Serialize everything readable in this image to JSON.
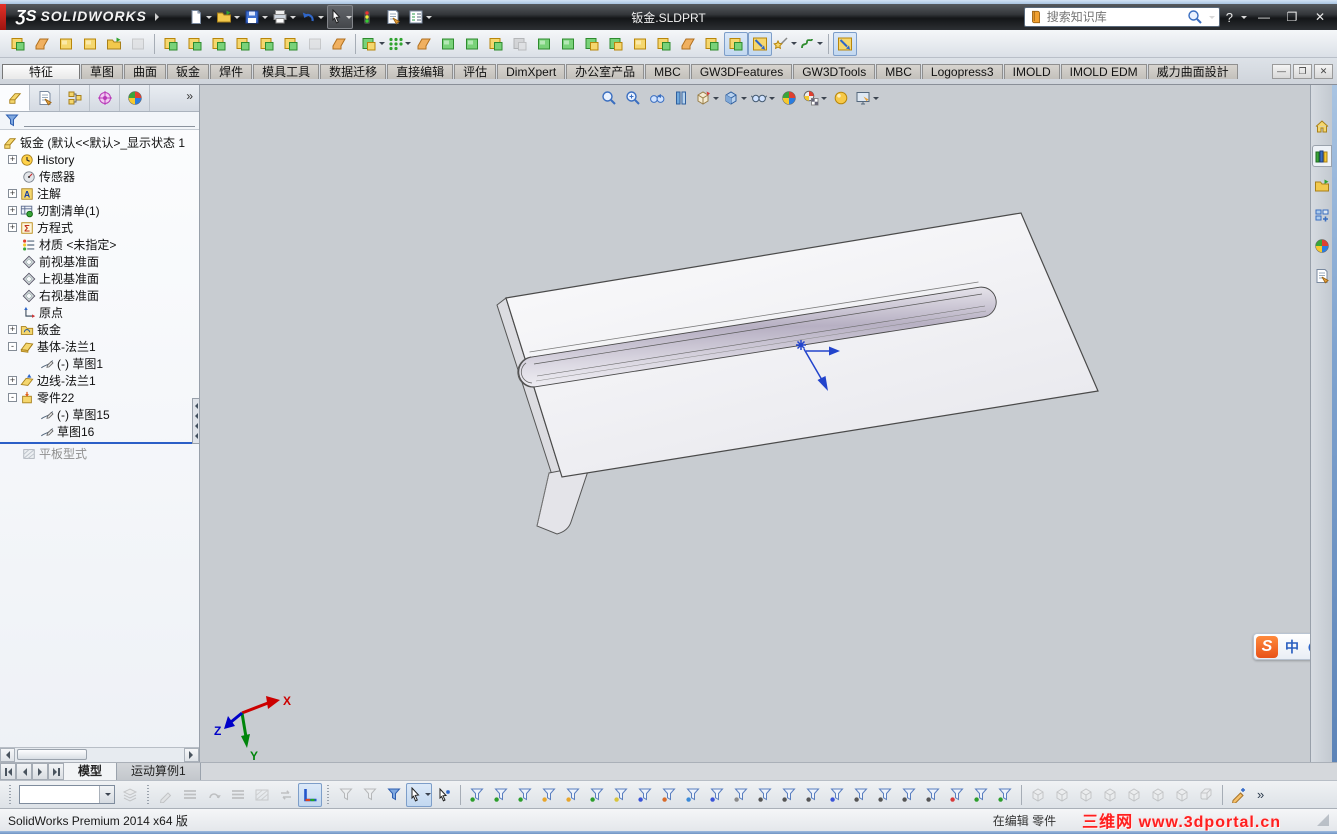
{
  "titlebar": {
    "ds_mark": "ƷS",
    "brand": "SOLIDWORKS",
    "title": "钣金.SLDPRT",
    "search_placeholder": "搜索知识库",
    "help": "?",
    "win_min": "—",
    "win_max": "❐",
    "win_close": "✕"
  },
  "quick_access": [
    {
      "n": "new-document",
      "k": "doc",
      "caret": true
    },
    {
      "n": "open-document",
      "k": "folder",
      "caret": true
    },
    {
      "n": "save",
      "k": "disk",
      "caret": true
    },
    {
      "n": "print",
      "k": "printer",
      "caret": true
    },
    {
      "n": "undo",
      "k": "undo",
      "caret": true
    },
    {
      "n": "select",
      "k": "cursor",
      "caret": true,
      "boxed": true
    },
    {
      "n": "rebuild-stoplight",
      "k": "stoplight"
    },
    {
      "n": "file-properties",
      "k": "sheet"
    },
    {
      "n": "options-list",
      "k": "list",
      "caret": true
    }
  ],
  "sheetmetal_toolbar": [
    {
      "n": "base-flange",
      "k": "yg"
    },
    {
      "n": "sketched-bend",
      "k": "orange"
    },
    {
      "n": "lofted-bend",
      "k": "y"
    },
    {
      "n": "swept-flange",
      "k": "y"
    },
    {
      "n": "open-part",
      "k": "folder"
    },
    {
      "n": "fold-gray",
      "k": "gray",
      "dis": true
    },
    {
      "t": "sep"
    },
    {
      "n": "extruded-cut",
      "k": "yg"
    },
    {
      "n": "simple-hole",
      "k": "yg"
    },
    {
      "n": "vent",
      "k": "yg"
    },
    {
      "n": "forming-tool",
      "k": "yg"
    },
    {
      "n": "sketch-driven",
      "k": "yg"
    },
    {
      "n": "tab-feature",
      "k": "yg"
    },
    {
      "n": "swap-gray",
      "k": "gray",
      "dis": true
    },
    {
      "n": "stacked-sheet",
      "k": "orange"
    },
    {
      "t": "sep"
    },
    {
      "n": "corner-relief",
      "k": "gy",
      "caret": true
    },
    {
      "n": "pattern-grid",
      "k": "grid",
      "caret": true
    },
    {
      "n": "miter-flange",
      "k": "orange"
    },
    {
      "n": "edge-flange",
      "k": "g"
    },
    {
      "n": "hem",
      "k": "g"
    },
    {
      "n": "jog",
      "k": "yg"
    },
    {
      "n": "closed-corner",
      "k": "gy",
      "dis": true
    },
    {
      "n": "round-boss",
      "k": "g"
    },
    {
      "n": "curl",
      "k": "g"
    },
    {
      "n": "gusset",
      "k": "gy"
    },
    {
      "n": "cross-break",
      "k": "gy"
    },
    {
      "n": "rip",
      "k": "y"
    },
    {
      "n": "canister",
      "k": "yg"
    },
    {
      "n": "break-corner",
      "k": "orange"
    },
    {
      "n": "weld-corner",
      "k": "yg"
    },
    {
      "n": "flatten",
      "k": "yg",
      "pressed": true
    },
    {
      "n": "insert-bends",
      "k": "bluearrow",
      "pressed": true
    },
    {
      "n": "convert-wand",
      "k": "wand",
      "caret": true
    },
    {
      "n": "spline-tool",
      "k": "squig",
      "caret": true
    },
    {
      "t": "sep"
    },
    {
      "n": "no-bends",
      "k": "bluearrow",
      "pressed": true
    }
  ],
  "commandmanager": {
    "tabs": [
      {
        "label": "特征",
        "active": true
      },
      {
        "label": "草图"
      },
      {
        "label": "曲面"
      },
      {
        "label": "钣金"
      },
      {
        "label": "焊件"
      },
      {
        "label": "模具工具"
      },
      {
        "label": "数据迁移"
      },
      {
        "label": "直接编辑"
      },
      {
        "label": "评估"
      },
      {
        "label": "DimXpert"
      },
      {
        "label": "办公室产品"
      },
      {
        "label": "MBC"
      },
      {
        "label": "GW3DFeatures"
      },
      {
        "label": "GW3DTools"
      },
      {
        "label": "MBC"
      },
      {
        "label": "Logopress3"
      },
      {
        "label": "IMOLD"
      },
      {
        "label": "IMOLD EDM"
      },
      {
        "label": "威力曲面設計"
      }
    ],
    "doc_min": "—",
    "doc_restore": "❐",
    "doc_close": "✕"
  },
  "featuremanager": {
    "tabs": [
      {
        "n": "featuremanager-design-tree",
        "k": "part",
        "active": true
      },
      {
        "n": "propertymanager",
        "k": "sheet"
      },
      {
        "n": "configurationmanager",
        "k": "config"
      },
      {
        "n": "dimxpertmanager",
        "k": "target"
      },
      {
        "n": "displaymanager",
        "k": "rgb"
      }
    ],
    "overflow": "»",
    "plus": "+",
    "minus": "-",
    "root": "钣金 (默认<<默认>_显示状态 1",
    "items": [
      {
        "label": "History",
        "icon": "history",
        "expand": "plus"
      },
      {
        "label": "传感器",
        "icon": "sensors"
      },
      {
        "label": "注解",
        "icon": "annA",
        "expand": "plus"
      },
      {
        "label": "切割清单(1)",
        "icon": "cutlist",
        "expand": "plus"
      },
      {
        "label": "方程式",
        "icon": "sigma",
        "expand": "plus"
      },
      {
        "label": "材质 <未指定>",
        "icon": "material"
      },
      {
        "label": "前视基准面",
        "icon": "plane"
      },
      {
        "label": "上视基准面",
        "icon": "plane"
      },
      {
        "label": "右视基准面",
        "icon": "plane"
      },
      {
        "label": "原点",
        "icon": "origin"
      },
      {
        "label": "钣金",
        "icon": "smfold",
        "expand": "plus"
      },
      {
        "label": "基体-法兰1",
        "icon": "baseflange",
        "expand": "minus"
      },
      {
        "label": "(-) 草图1",
        "icon": "sketch",
        "indent": 1
      },
      {
        "label": "边线-法兰1",
        "icon": "edgeflange",
        "expand": "plus"
      },
      {
        "label": "零件22",
        "icon": "part22",
        "expand": "minus"
      },
      {
        "label": "(-) 草图15",
        "icon": "sketch",
        "indent": 1
      },
      {
        "label": "草图16",
        "icon": "sketch",
        "indent": 1
      },
      {
        "label": "平板型式",
        "icon": "flatpat",
        "dim": true,
        "below_rollback": true
      }
    ]
  },
  "headsup": [
    {
      "n": "zoom-to-fit",
      "k": "mag"
    },
    {
      "n": "zoom-to-area",
      "k": "magp"
    },
    {
      "n": "previous-view",
      "k": "binoc"
    },
    {
      "n": "section-view",
      "k": "section"
    },
    {
      "n": "view-orientation",
      "k": "cubeor",
      "caret": true
    },
    {
      "n": "display-style",
      "k": "cubebl",
      "caret": true
    },
    {
      "n": "hide-show-items",
      "k": "glasses",
      "caret": true
    },
    {
      "n": "edit-appearance",
      "k": "rgb"
    },
    {
      "n": "apply-scene",
      "k": "checker",
      "caret": true
    },
    {
      "n": "view-settings-light",
      "k": "bally"
    },
    {
      "n": "camera-settings",
      "k": "monitor",
      "caret": true
    }
  ],
  "taskpane": [
    {
      "n": "home",
      "k": "home"
    },
    {
      "n": "resources",
      "k": "books",
      "active": true
    },
    {
      "n": "design-library",
      "k": "folder"
    },
    {
      "n": "file-explorer",
      "k": "explorer"
    },
    {
      "n": "appearances-scenes",
      "k": "rgb"
    },
    {
      "n": "custom-properties",
      "k": "sheet"
    }
  ],
  "viewport": {
    "axis_x": "X",
    "axis_y": "Y",
    "axis_z": "Z"
  },
  "model_bar": {
    "tabs": [
      {
        "label": "模型",
        "active": true
      },
      {
        "label": "运动算例1"
      }
    ]
  },
  "bottom_toolbar": {
    "overflow": "»",
    "items": [
      {
        "t": "grip"
      },
      {
        "t": "combo",
        "n": "layer-combo"
      },
      {
        "n": "layer-properties",
        "k": "layers",
        "dis": true
      },
      {
        "t": "grip"
      },
      {
        "n": "line-color",
        "k": "pen2",
        "dis": true
      },
      {
        "n": "line-thickness",
        "k": "lines",
        "dis": true
      },
      {
        "n": "line-style",
        "k": "loop",
        "dis": true
      },
      {
        "n": "hide-edge",
        "k": "lines",
        "dis": true
      },
      {
        "n": "show-edge",
        "k": "hatch",
        "dis": true
      },
      {
        "n": "flip-side",
        "k": "swap",
        "dis": true
      },
      {
        "n": "grid-snap",
        "k": "gridsnap",
        "pressed": true
      },
      {
        "t": "grip"
      },
      {
        "n": "filter-off",
        "k": "funnel",
        "dis": true
      },
      {
        "n": "clear-all-filters",
        "k": "funnel",
        "dis": true
      },
      {
        "n": "toggle-selection-filters",
        "k": "funnelb"
      },
      {
        "n": "select-tool",
        "k": "cursor",
        "pressed": true,
        "caret": true
      },
      {
        "n": "select-other",
        "k": "curstar"
      },
      {
        "t": "sep"
      },
      {
        "n": "filter-vertices",
        "k": "funnel",
        "d": "#2d9e2d"
      },
      {
        "n": "filter-edges",
        "k": "funnel",
        "d": "#2d9e2d"
      },
      {
        "n": "filter-faces",
        "k": "funnel",
        "d": "#2d9e2d"
      },
      {
        "n": "filter-surface-bodies",
        "k": "funnel",
        "d": "#e8a52a"
      },
      {
        "n": "filter-solid-bodies",
        "k": "funnel",
        "d": "#e8a52a"
      },
      {
        "n": "filter-axes",
        "k": "funnel",
        "d": "#2d9e2d"
      },
      {
        "n": "filter-planes",
        "k": "funnel",
        "d": "#d8c43a"
      },
      {
        "n": "filter-sketch-points",
        "k": "funnel",
        "d": "#3a55d8"
      },
      {
        "n": "filter-sketch-segments",
        "k": "funnel",
        "d": "#d86a2a"
      },
      {
        "n": "filter-midpoints",
        "k": "funnel",
        "d": "#3a8ad8"
      },
      {
        "n": "filter-center-marks",
        "k": "funnel",
        "d": "#3a55d8"
      },
      {
        "n": "filter-centerlines",
        "k": "funnel",
        "d": "#8a8a8a"
      },
      {
        "n": "filter-dimensions",
        "k": "funnel",
        "d": "#555555"
      },
      {
        "n": "filter-hole-callouts",
        "k": "funnel",
        "d": "#555555"
      },
      {
        "n": "filter-notes",
        "k": "funnel",
        "d": "#555555"
      },
      {
        "n": "filter-balloons",
        "k": "funnel",
        "d": "#3a55d8"
      },
      {
        "n": "filter-weld-symbols",
        "k": "funnel",
        "d": "#555555"
      },
      {
        "n": "filter-gtol-symbols",
        "k": "funnel",
        "d": "#555555"
      },
      {
        "n": "filter-surface-finish",
        "k": "funnel",
        "d": "#555555"
      },
      {
        "n": "filter-datum-features",
        "k": "funnel",
        "d": "#555555"
      },
      {
        "n": "filter-shaded-faces",
        "k": "funnel",
        "d": "#d83a3a"
      },
      {
        "n": "filter-connection-points",
        "k": "funnel",
        "d": "#2d9e2d"
      },
      {
        "n": "filter-routing-points",
        "k": "funnel",
        "d": "#2d9e2d"
      },
      {
        "t": "sep"
      },
      {
        "n": "view-front",
        "k": "cubegr",
        "dis": true
      },
      {
        "n": "view-back",
        "k": "cubegr",
        "dis": true
      },
      {
        "n": "view-left",
        "k": "cubegr",
        "dis": true
      },
      {
        "n": "view-right",
        "k": "cubegr",
        "dis": true
      },
      {
        "n": "view-top",
        "k": "cubegr",
        "dis": true
      },
      {
        "n": "view-bottom",
        "k": "cubegr",
        "dis": true
      },
      {
        "n": "view-isometric",
        "k": "cubegr",
        "dis": true
      },
      {
        "n": "view-trimetric",
        "k": "cubecorner",
        "dis": true
      },
      {
        "t": "sep"
      },
      {
        "n": "edit-sketch",
        "k": "sketchstar"
      },
      {
        "t": "chev"
      }
    ]
  },
  "statusbar": {
    "left": "SolidWorks Premium 2014 x64 版",
    "editing": "在编辑 零件",
    "watermark": "三维网 www.3dportal.cn"
  },
  "ime": {
    "logo": "S",
    "lang": "中"
  }
}
